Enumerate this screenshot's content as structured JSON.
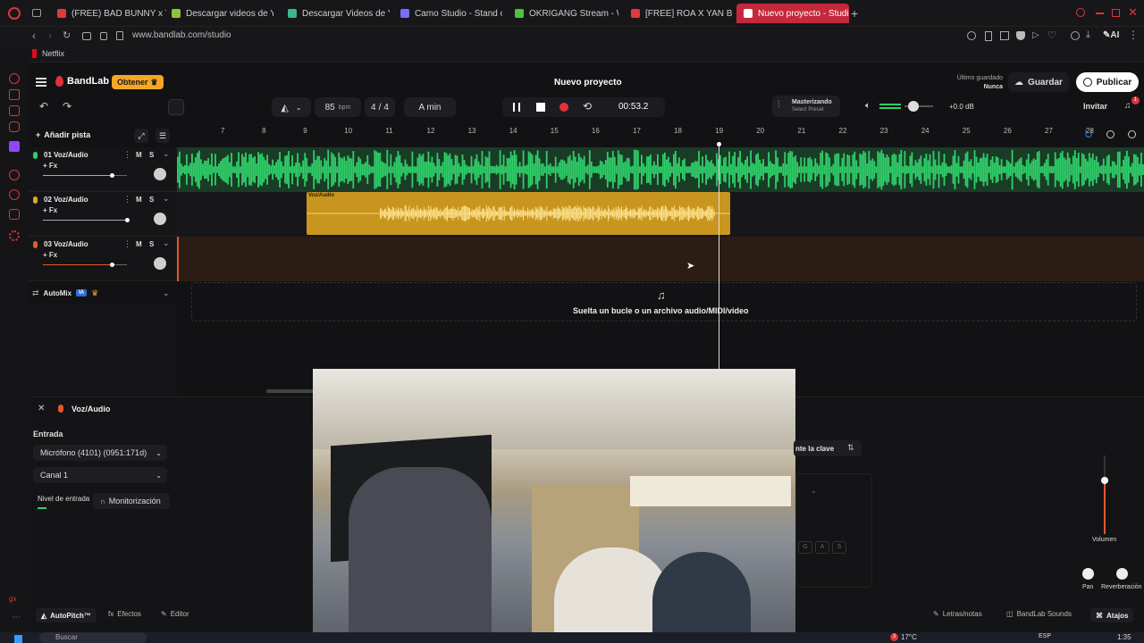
{
  "browser": {
    "tabs": [
      {
        "label": "(FREE) BAD BUNNY x TAIN",
        "color": "#e03a3a"
      },
      {
        "label": "Descargar videos de YouT",
        "color": "#8ac43a"
      },
      {
        "label": "Descargar Videos de You",
        "color": "#3ab88a"
      },
      {
        "label": "Camo Studio - Stand out",
        "color": "#7a6cff"
      },
      {
        "label": "OKRIGANG Stream - Wate",
        "color": "#4ac43a"
      },
      {
        "label": "[FREE] ROA X YAN BLOCK",
        "color": "#e03a3a"
      },
      {
        "label": "Nuevo proyecto - Studi",
        "color": "#ffffff"
      }
    ],
    "url": "www.bandlab.com/studio",
    "bookmark": "Netflix",
    "ai_label": "AI"
  },
  "header": {
    "brand": "BandLab",
    "get_label": "Obtener",
    "project_title": "Nuevo proyecto",
    "last_saved_label": "Último guardado",
    "last_saved_value": "Nunca",
    "save_label": "Guardar",
    "publish_label": "Publicar"
  },
  "toolbar": {
    "tempo": "85",
    "tempo_unit": "bpm",
    "time_sig_num": "4",
    "time_sig_sep": "/",
    "time_sig_den": "4",
    "key": "A min",
    "time": "00:53.2",
    "mastering_label": "Masterizando",
    "preset_label": "Select Preset",
    "volume_db": "+0.0 dB",
    "invite_label": "Invitar",
    "notification_count": "1"
  },
  "tracks_header": {
    "add_track": "Añadir pista"
  },
  "ruler": [
    "7",
    "8",
    "9",
    "10",
    "11",
    "12",
    "13",
    "14",
    "15",
    "16",
    "17",
    "18",
    "19",
    "20",
    "21",
    "22",
    "23",
    "24",
    "25",
    "26",
    "27",
    "28"
  ],
  "tracks": [
    {
      "num": "01",
      "name": "Voz/Audio",
      "fx": "+ Fx",
      "mute": "M",
      "solo": "S",
      "color": "#2fcf6a",
      "volume": 0.82
    },
    {
      "num": "02",
      "name": "Voz/Audio",
      "fx": "+ Fx",
      "mute": "M",
      "solo": "S",
      "color": "#e0a526",
      "volume": 1.0
    },
    {
      "num": "03",
      "name": "Voz/Audio",
      "fx": "+ Fx",
      "mute": "M",
      "solo": "S",
      "color": "#e05a2a",
      "volume": 0.82
    }
  ],
  "clip_label": "Voz/Audio",
  "automix": {
    "label": "AutoMix",
    "badge": "IA"
  },
  "drop_text": "Suelta un bucle o un archivo audio/MIDI/video",
  "bottom_panel": {
    "title": "Voz/Audio",
    "input_label": "Entrada",
    "mic_value": "Micrófono (4101) (0951:171d)",
    "channel_value": "Canal 1",
    "level_label": "Nivel de entrada",
    "monitor_label": "Monitorización",
    "key_label": "nte la clave",
    "volume_label": "Volumen",
    "pan_label": "Pan",
    "reverb_label": "Reverberación",
    "voice_buttons": [
      "G",
      "A",
      "S"
    ]
  },
  "footer": {
    "autopitch": "AutoPitch™",
    "effects": "Efectos",
    "editor": "Editor",
    "lyrics": "Letras/notas",
    "sounds": "BandLab Sounds",
    "shortcuts": "Atajos"
  },
  "taskbar": {
    "search_placeholder": "Buscar",
    "weather": "17°C",
    "lang": "ESP",
    "clock": "1:35",
    "weather_badge": "3"
  },
  "colors": {
    "accent": "#e0323c",
    "green": "#2fcf6a",
    "orange": "#e0a526",
    "red_track": "#e05a2a"
  }
}
